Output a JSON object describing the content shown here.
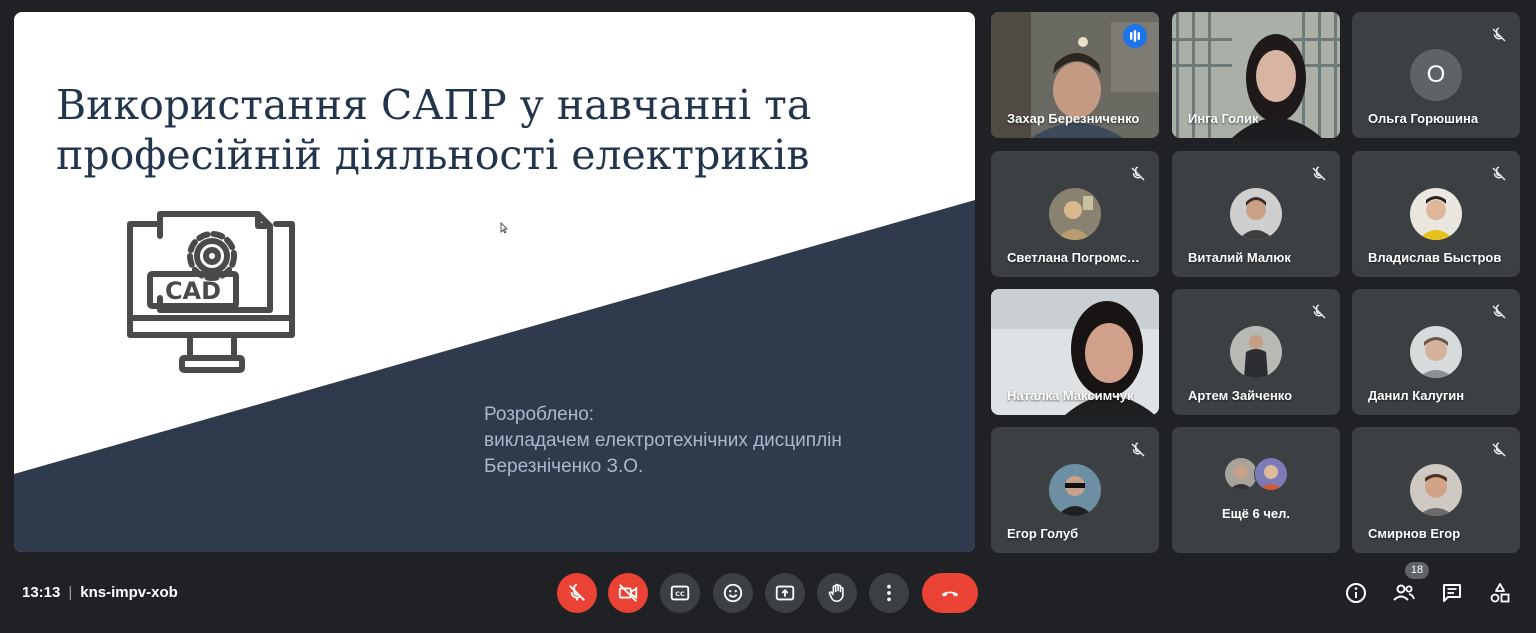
{
  "slide": {
    "title_line1": "Використання САПР у навчанні та",
    "title_line2": "професійній діяльності електриків",
    "cad_label": "CAD",
    "credits_line1": "Розроблено:",
    "credits_line2": "викладачем електротехнічних дисциплін",
    "credits_line3": "Березніченко З.О."
  },
  "participants": [
    {
      "name": "Захар Березниченко",
      "muted": false,
      "speaking": true
    },
    {
      "name": "Инга Голик",
      "muted": false
    },
    {
      "name": "Ольга Горюшина",
      "muted": true,
      "initial": "О"
    },
    {
      "name": "Светлана Погромская",
      "muted": true
    },
    {
      "name": "Виталий Малюк",
      "muted": true
    },
    {
      "name": "Владислав Быстров",
      "muted": true
    },
    {
      "name": "Наталка Максимчук",
      "muted": false
    },
    {
      "name": "Артем Зайченко",
      "muted": true
    },
    {
      "name": "Данил Калугин",
      "muted": true
    },
    {
      "name": "Егор Голуб",
      "muted": true
    },
    {
      "name": "Ещё 6 чел."
    },
    {
      "name": "Смирнов Егор",
      "muted": true
    }
  ],
  "meeting": {
    "time": "13:13",
    "code": "kns-impv-xob",
    "participant_count": "18"
  },
  "controls": {
    "mic": "mic-off-icon",
    "camera": "camera-off-icon",
    "captions": "captions-icon",
    "reactions": "emoji-icon",
    "present": "present-screen-icon",
    "raise_hand": "hand-icon",
    "more": "more-vert-icon",
    "leave": "phone-hangup-icon",
    "info": "info-icon",
    "people": "people-icon",
    "chat": "chat-icon",
    "activities": "activities-icon"
  },
  "colors": {
    "accent_red": "#ea4335",
    "speaking_blue": "#1a73e8",
    "tile_bg": "#3c4043",
    "slide_navy": "#2f3a4c"
  }
}
